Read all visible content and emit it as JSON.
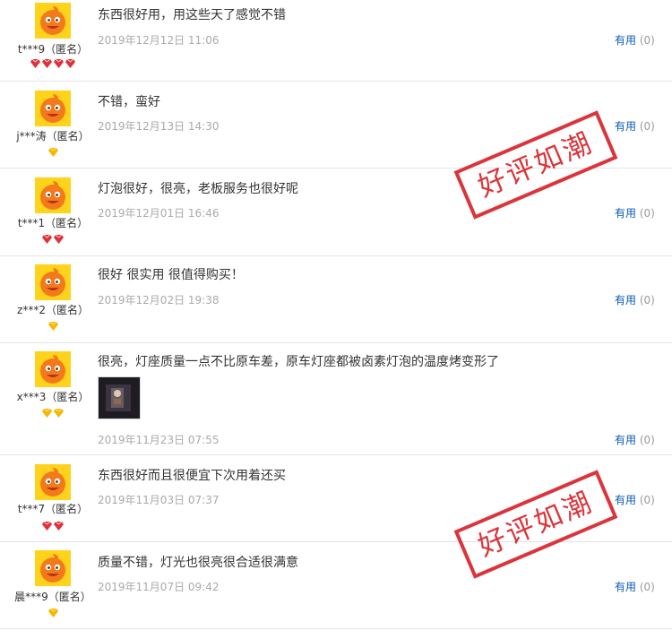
{
  "colors": {
    "link": "#0b5bb0",
    "date": "#aaaaaa",
    "stamp": "#d8232a",
    "gem_red": "#e0303a",
    "gem_gold": "#f5b800",
    "avatar_bg": "#ffd21c"
  },
  "stamp_text": "好评如潮",
  "reviews": [
    {
      "user": "t***9（匿名）",
      "content": "东西很好用，用这些天了感觉不错",
      "date": "2019年12月12日 11:06",
      "useful_label": "有用",
      "useful_count": "(0)",
      "gems": 4,
      "gem_type": "red"
    },
    {
      "user": "j***涛（匿名）",
      "content": "不错，蛮好",
      "date": "2019年12月13日 14:30",
      "useful_label": "有用",
      "useful_count": "(0)",
      "gems": 1,
      "gem_type": "gold"
    },
    {
      "user": "t***1（匿名）",
      "content": "灯泡很好，很亮，老板服务也很好呢",
      "date": "2019年12月01日 16:46",
      "useful_label": "有用",
      "useful_count": "(0)",
      "gems": 2,
      "gem_type": "red"
    },
    {
      "user": "z***2（匿名）",
      "content": "很好 很实用 很值得购买！",
      "date": "2019年12月02日 19:38",
      "useful_label": "有用",
      "useful_count": "(0)",
      "gems": 1,
      "gem_type": "gold"
    },
    {
      "user": "x***3（匿名）",
      "content": "很亮，灯座质量一点不比原车差，原车灯座都被卤素灯泡的温度烤变形了",
      "date": "2019年11月23日 07:55",
      "useful_label": "有用",
      "useful_count": "(0)",
      "gems": 2,
      "gem_type": "gold"
    },
    {
      "user": "t***7（匿名）",
      "content": "东西很好而且很便宜下次用着还买",
      "date": "2019年11月03日 07:37",
      "useful_label": "有用",
      "useful_count": "(0)",
      "gems": 2,
      "gem_type": "red"
    },
    {
      "user": "晨***9（匿名）",
      "content": "质量不错，灯光也很亮很合适很满意",
      "date": "2019年11月07日 09:42",
      "useful_label": "有用",
      "useful_count": "(0)",
      "gems": 1,
      "gem_type": "gold"
    }
  ]
}
